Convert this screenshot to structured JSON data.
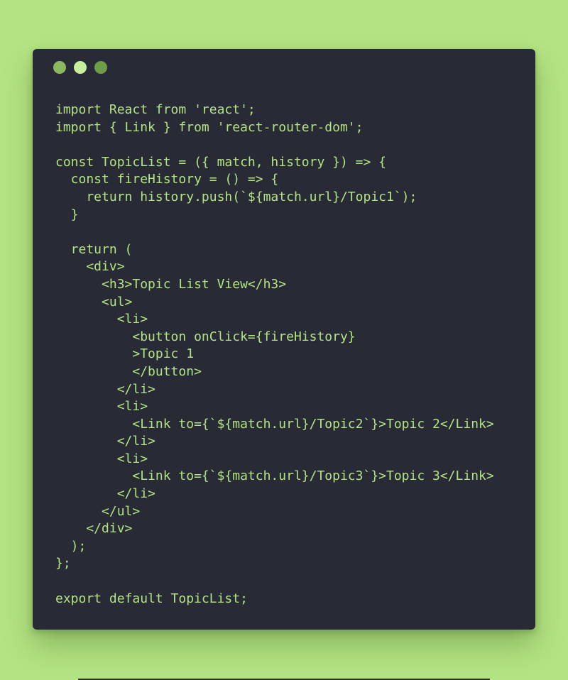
{
  "window": {
    "controls": [
      "close",
      "minimize",
      "maximize"
    ]
  },
  "colors": {
    "background": "#b4e383",
    "window": "#282b36",
    "code_text": "#b4e383",
    "dot_close": "#8bb85e",
    "dot_minimize": "#c7ee9c",
    "dot_maximize": "#6f9c46"
  },
  "code": {
    "lines": [
      "import React from 'react';",
      "import { Link } from 'react-router-dom';",
      "",
      "const TopicList = ({ match, history }) => {",
      "  const fireHistory = () => {",
      "    return history.push(`${match.url}/Topic1`);",
      "  }",
      "",
      "  return (",
      "    <div>",
      "      <h3>Topic List View</h3>",
      "      <ul>",
      "        <li>",
      "          <button onClick={fireHistory}",
      "          >Topic 1",
      "          </button>",
      "        </li>",
      "        <li>",
      "          <Link to={`${match.url}/Topic2`}>Topic 2</Link>",
      "        </li>",
      "        <li>",
      "          <Link to={`${match.url}/Topic3`}>Topic 3</Link>",
      "        </li>",
      "      </ul>",
      "    </div>",
      "  );",
      "};",
      "",
      "export default TopicList;"
    ]
  }
}
